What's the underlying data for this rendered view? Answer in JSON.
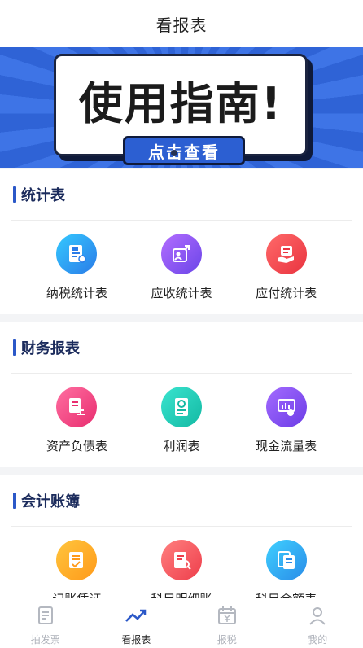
{
  "header": {
    "title": "看报表"
  },
  "banner": {
    "headline": "使用指南!",
    "button_label": "点击查看"
  },
  "sections": [
    {
      "title": "统计表",
      "items": [
        {
          "label": "纳税统计表",
          "icon": "tax-form-icon",
          "color": "#2a7be8"
        },
        {
          "label": "应收统计表",
          "icon": "receivable-icon",
          "color": "#6a45e8"
        },
        {
          "label": "应付统计表",
          "icon": "payable-icon",
          "color": "#e9333f"
        }
      ]
    },
    {
      "title": "财务报表",
      "items": [
        {
          "label": "资产负债表",
          "icon": "balance-sheet-icon",
          "color": "#e82d6f"
        },
        {
          "label": "利润表",
          "icon": "profit-icon",
          "color": "#13b9a3"
        },
        {
          "label": "现金流量表",
          "icon": "cash-flow-icon",
          "color": "#6b3ce6"
        }
      ]
    },
    {
      "title": "会计账簿",
      "items": [
        {
          "label": "记账凭证",
          "icon": "voucher-icon",
          "color": "#ff9a1a"
        },
        {
          "label": "科目明细账",
          "icon": "ledger-detail-icon",
          "color": "#ee3e4b"
        },
        {
          "label": "科目余额表",
          "icon": "balance-table-icon",
          "color": "#2a8ce8"
        }
      ]
    }
  ],
  "tabbar": [
    {
      "label": "拍发票",
      "icon": "invoice-icon",
      "active": false
    },
    {
      "label": "看报表",
      "icon": "trend-icon",
      "active": true
    },
    {
      "label": "报税",
      "icon": "tax-calendar-icon",
      "active": false
    },
    {
      "label": "我的",
      "icon": "user-icon",
      "active": false
    }
  ]
}
